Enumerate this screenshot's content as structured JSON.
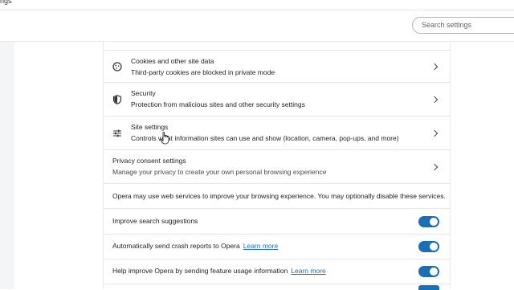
{
  "window": {
    "title": "ngs"
  },
  "search": {
    "placeholder": "Search settings"
  },
  "rows": {
    "cookies": {
      "title": "Cookies and other site data",
      "subtitle": "Third-party cookies are blocked in private mode"
    },
    "security": {
      "title": "Security",
      "subtitle": "Protection from malicious sites and other security settings"
    },
    "site_settings": {
      "title": "Site settings",
      "subtitle": "Controls what information sites can use and show (location, camera, pop-ups, and more)"
    },
    "privacy_consent": {
      "title": "Privacy consent settings",
      "subtitle": "Manage your privacy to create your own personal browsing experience"
    }
  },
  "notice": "Opera may use web services to improve your browsing experience. You may optionally disable these services.",
  "toggles": [
    {
      "label": "Improve search suggestions",
      "link": "",
      "on": true
    },
    {
      "label": "Automatically send crash reports to Opera",
      "link": "Learn more",
      "on": true
    },
    {
      "label": "Help improve Opera by sending feature usage information",
      "link": "Learn more",
      "on": true
    }
  ],
  "colors": {
    "accent": "#1a6fb5",
    "search_border": "#9bb7c9"
  },
  "icons": {
    "cookies": "cookie-icon",
    "security": "shield-icon",
    "site_settings": "sliders-icon",
    "chevron": "chevron-right-icon"
  }
}
